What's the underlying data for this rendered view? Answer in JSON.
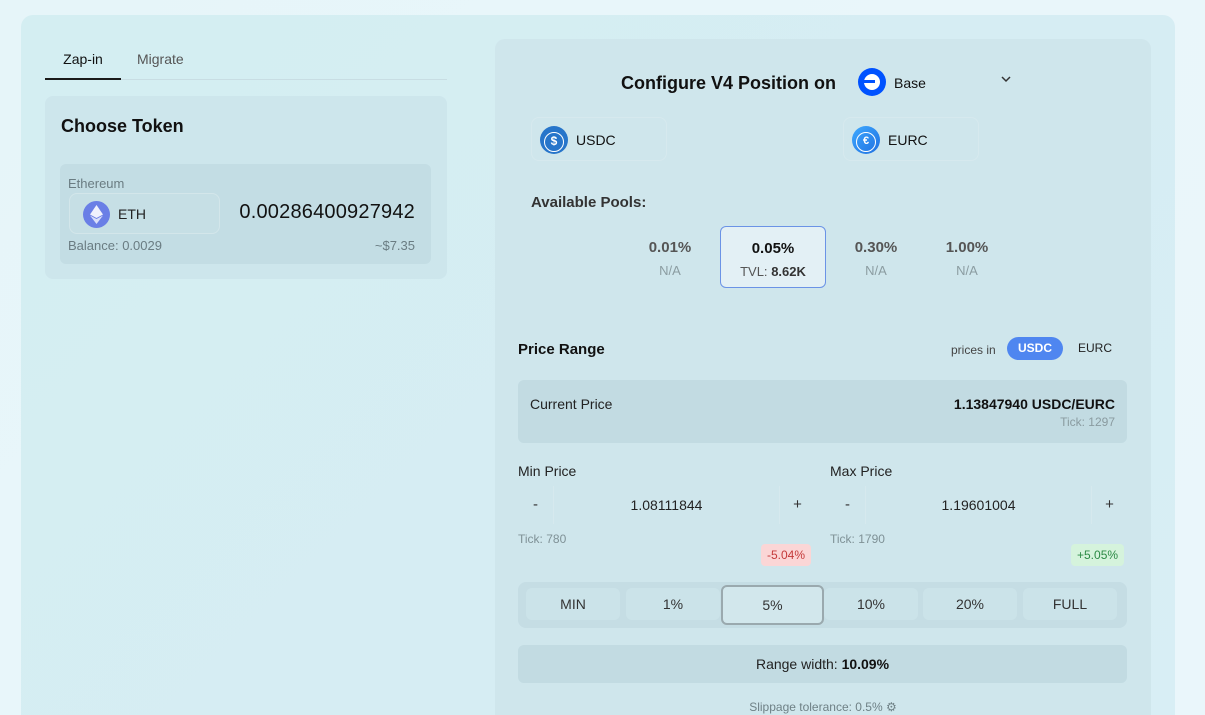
{
  "tabs": [
    {
      "label": "Zap-in",
      "active": true
    },
    {
      "label": "Migrate",
      "active": false
    }
  ],
  "choose_token": {
    "title": "Choose Token",
    "chain": "Ethereum",
    "token_symbol": "ETH",
    "amount": "0.00286400927942",
    "balance": "Balance: 0.0029",
    "usd_value": "~$7.35"
  },
  "configure": {
    "title": "Configure V4 Position on",
    "chain_name": "Base",
    "token0": "USDC",
    "token1": "EURC"
  },
  "pools": {
    "label": "Available Pools:",
    "items": [
      {
        "fee": "0.01%",
        "tvl_text": "N/A",
        "selected": false
      },
      {
        "fee": "0.05%",
        "tvl_prefix": "TVL:",
        "tvl_value": "8.62K",
        "selected": true
      },
      {
        "fee": "0.30%",
        "tvl_text": "N/A",
        "selected": false
      },
      {
        "fee": "1.00%",
        "tvl_text": "N/A",
        "selected": false
      }
    ]
  },
  "price_range": {
    "title": "Price Range",
    "prices_in_label": "prices in",
    "toggle_active": "USDC",
    "toggle_inactive": "EURC",
    "current_label": "Current Price",
    "current_value": "1.13847940 USDC/EURC",
    "current_tick": "Tick: 1297",
    "min_label": "Min Price",
    "min_value": "1.08111844",
    "min_tick": "Tick: 780",
    "min_pct": "-5.04%",
    "max_label": "Max Price",
    "max_value": "1.19601004",
    "max_tick": "Tick: 1790",
    "max_pct": "+5.05%",
    "minus": "-",
    "plus": "+",
    "presets": [
      "MIN",
      "1%",
      "5%",
      "10%",
      "20%",
      "FULL"
    ],
    "selected_preset": "5%",
    "range_width_label": "Range width:",
    "range_width_value": "10.09%",
    "slippage": "Slippage tolerance: 0.5%"
  },
  "colors": {
    "accent": "#4f86f0",
    "selected_border": "#6b93e6",
    "negative": "#c43a3a",
    "positive": "#2c8a45"
  },
  "icons": [
    "eth-icon",
    "base-icon",
    "usdc-icon",
    "eurc-icon",
    "chevron-down-icon",
    "gear-icon"
  ]
}
